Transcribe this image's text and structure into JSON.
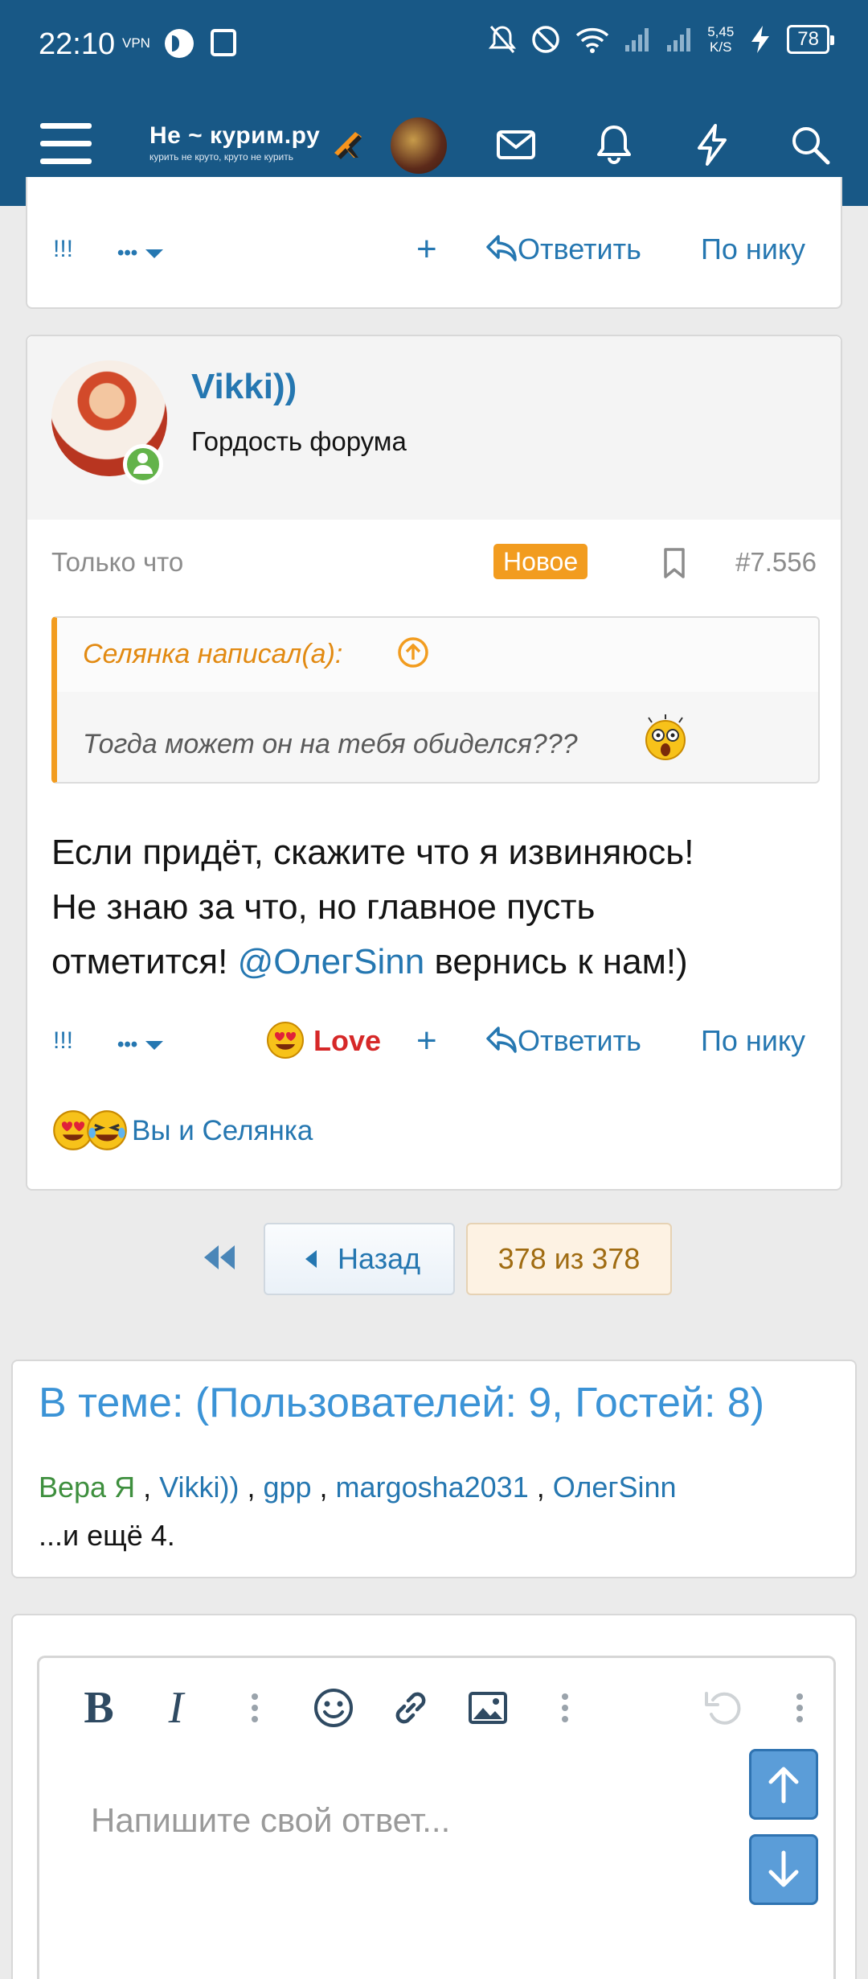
{
  "status_bar": {
    "time": "22:10",
    "vpn": "VPN",
    "speed_top": "5,45",
    "speed_bottom": "K/S",
    "battery": "78"
  },
  "header": {
    "logo_title": "Не ~ курим.ру",
    "logo_subtitle": "курить не круто, круто не курить",
    "icons": [
      "menu-icon",
      "inbox-icon",
      "bell-icon",
      "lightning-icon",
      "search-icon"
    ]
  },
  "prev_post_actions": {
    "report": "!!!",
    "more": "•••",
    "add": "+",
    "reply": "Ответить",
    "by_nick": "По нику"
  },
  "post": {
    "author": "Vikki))",
    "user_title": "Гордость форума",
    "time": "Только что",
    "badge": "Новое",
    "number": "#7.556",
    "quote": {
      "author": "Селянка написал(а):",
      "text": "Тогда может он на тебя обиделся???"
    },
    "body_line1": "Если придёт, скажите что я извиняюсь!",
    "body_line2": "Не знаю за что, но главное пусть",
    "body_line3_pre": "отметится! ",
    "mention": "@ОлегSinn",
    "body_line3_post": " вернись к нам!)",
    "actions": {
      "report": "!!!",
      "more": "•••",
      "reaction": "Love",
      "add": "+",
      "reply": "Ответить",
      "by_nick": "По нику"
    },
    "reactions_text": "Вы и Селянка"
  },
  "pagination": {
    "back": "Назад",
    "current": "378 из 378"
  },
  "online": {
    "title": "В теме: (Пользователей: 9, Гостей: 8)",
    "users": [
      "Вера Я",
      "Vikki))",
      "gpp",
      "margosha2031",
      "ОлегSinn"
    ],
    "more": "...и ещё 4."
  },
  "editor": {
    "placeholder": "Напишите свой ответ..."
  },
  "colors": {
    "header_bg": "#185886",
    "link": "#2577b1",
    "accent_orange": "#f29c1f",
    "love_red": "#d62828"
  }
}
